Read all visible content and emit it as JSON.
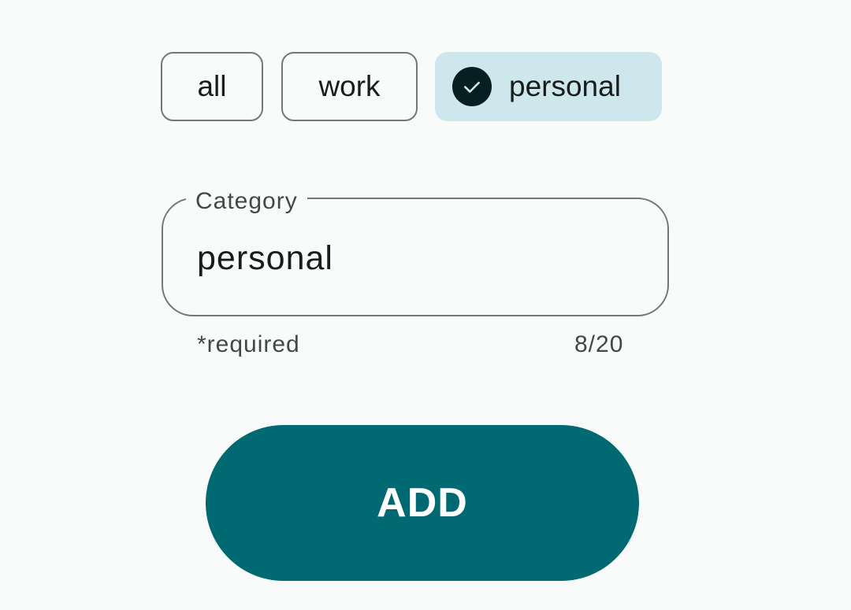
{
  "chips": {
    "all": {
      "label": "all",
      "selected": false
    },
    "work": {
      "label": "work",
      "selected": false
    },
    "personal": {
      "label": "personal",
      "selected": true
    }
  },
  "category_field": {
    "label": "Category",
    "value": "personal",
    "helper_text": "*required",
    "counter": "8/20"
  },
  "add_button": {
    "label": "ADD"
  },
  "colors": {
    "background": "#f9fbfb",
    "chip_outline": "#6f7979",
    "chip_selected_bg": "#cde7ec",
    "check_icon_bg": "#051f23",
    "primary_button": "#006972",
    "on_primary": "#ffffff"
  },
  "icons": {
    "selected_chip_icon": "check-circle-icon"
  }
}
